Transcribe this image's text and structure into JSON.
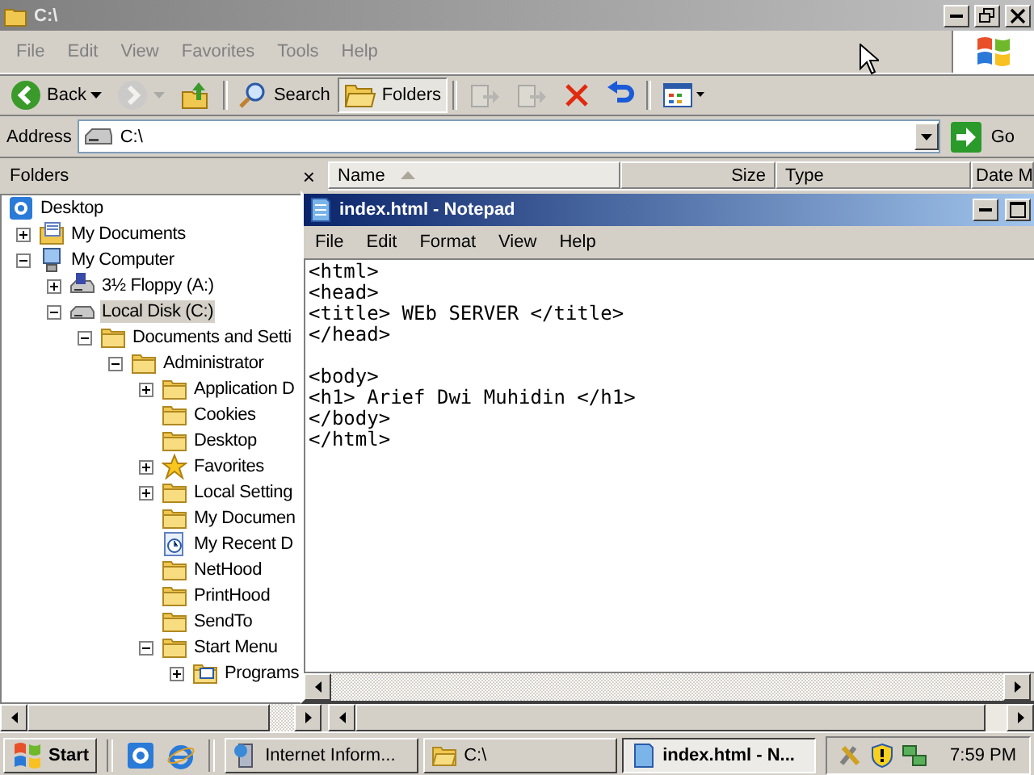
{
  "explorer": {
    "title": "C:\\",
    "active": false,
    "menu": [
      "File",
      "Edit",
      "View",
      "Favorites",
      "Tools",
      "Help"
    ],
    "toolbar": [
      {
        "kind": "back",
        "label": "Back",
        "disabled": false,
        "selected": false
      },
      {
        "kind": "forward",
        "disabled": true,
        "selected": false
      },
      {
        "kind": "up",
        "disabled": false,
        "selected": false
      },
      {
        "kind": "search",
        "label": "Search",
        "disabled": false,
        "selected": false
      },
      {
        "kind": "folders",
        "label": "Folders",
        "disabled": false,
        "selected": true
      },
      {
        "kind": "move",
        "disabled": true,
        "selected": false
      },
      {
        "kind": "copy",
        "disabled": true,
        "selected": false
      },
      {
        "kind": "delete",
        "disabled": false,
        "selected": false
      },
      {
        "kind": "undo",
        "disabled": false,
        "selected": false
      },
      {
        "kind": "views",
        "disabled": false,
        "selected": false
      }
    ],
    "address": {
      "label": "Address",
      "value": "C:\\",
      "go": "Go"
    },
    "folders": {
      "title": "Folders",
      "close": "×",
      "tree": [
        {
          "label": "Desktop",
          "kind": "desktop",
          "selected": false,
          "children": [
            {
              "label": "My Documents",
              "kind": "documents",
              "expanded": false,
              "selected": false
            },
            {
              "label": "My Computer",
              "kind": "computer",
              "expanded": true,
              "selected": false,
              "children": [
                {
                  "label": "3½ Floppy (A:)",
                  "kind": "floppy",
                  "expanded": false,
                  "selected": false
                },
                {
                  "label": "Local Disk (C:)",
                  "kind": "disk",
                  "expanded": true,
                  "selected": true,
                  "children": [
                    {
                      "label": "Documents and Setti",
                      "kind": "folder",
                      "expanded": true,
                      "selected": false,
                      "children": [
                        {
                          "label": "Administrator",
                          "kind": "folder",
                          "expanded": true,
                          "selected": false,
                          "children": [
                            {
                              "label": "Application D",
                              "kind": "folder",
                              "expanded": false,
                              "selected": false
                            },
                            {
                              "label": "Cookies",
                              "kind": "folder",
                              "selected": false
                            },
                            {
                              "label": "Desktop",
                              "kind": "folder",
                              "selected": false
                            },
                            {
                              "label": "Favorites",
                              "kind": "star",
                              "expanded": false,
                              "selected": false
                            },
                            {
                              "label": "Local Setting",
                              "kind": "folder",
                              "expanded": false,
                              "selected": false
                            },
                            {
                              "label": "My Documen",
                              "kind": "folder",
                              "selected": false
                            },
                            {
                              "label": "My Recent D",
                              "kind": "recent",
                              "selected": false
                            },
                            {
                              "label": "NetHood",
                              "kind": "folder",
                              "selected": false
                            },
                            {
                              "label": "PrintHood",
                              "kind": "folder",
                              "selected": false
                            },
                            {
                              "label": "SendTo",
                              "kind": "folder",
                              "selected": false
                            },
                            {
                              "label": "Start Menu",
                              "kind": "folder",
                              "expanded": true,
                              "selected": false,
                              "children": [
                                {
                                  "label": "Programs",
                                  "kind": "programs",
                                  "expanded": false,
                                  "selected": false
                                }
                              ]
                            }
                          ]
                        }
                      ]
                    }
                  ]
                }
              ]
            }
          ]
        }
      ]
    },
    "columns": [
      {
        "label": "Name",
        "sorted": true
      },
      {
        "label": "Size",
        "sorted": false
      },
      {
        "label": "Type",
        "sorted": false
      },
      {
        "label": "Date M",
        "sorted": false
      }
    ]
  },
  "notepad": {
    "title": "index.html - Notepad",
    "active": true,
    "menu": [
      "File",
      "Edit",
      "Format",
      "View",
      "Help"
    ],
    "paragraphs": [
      [
        "<html>",
        "<head>",
        "<title> WEb SERVER </title>",
        "</head>"
      ],
      [
        "<body>",
        "<h1> Arief Dwi Muhidin </h1>",
        "</body>",
        "</html>"
      ]
    ]
  },
  "taskbar": {
    "start": "Start",
    "quick_launch": [
      {
        "kind": "desktop"
      },
      {
        "kind": "browser"
      }
    ],
    "tasks": [
      {
        "label": "Internet Inform...",
        "kind": "iis",
        "selected": false
      },
      {
        "label": "C:\\",
        "kind": "folder",
        "selected": false
      },
      {
        "label": "index.html - N...",
        "kind": "notepad",
        "selected": true
      }
    ],
    "tray": [
      {
        "kind": "tools"
      },
      {
        "kind": "shield"
      },
      {
        "kind": "network"
      }
    ],
    "clock": "7:59 PM"
  }
}
